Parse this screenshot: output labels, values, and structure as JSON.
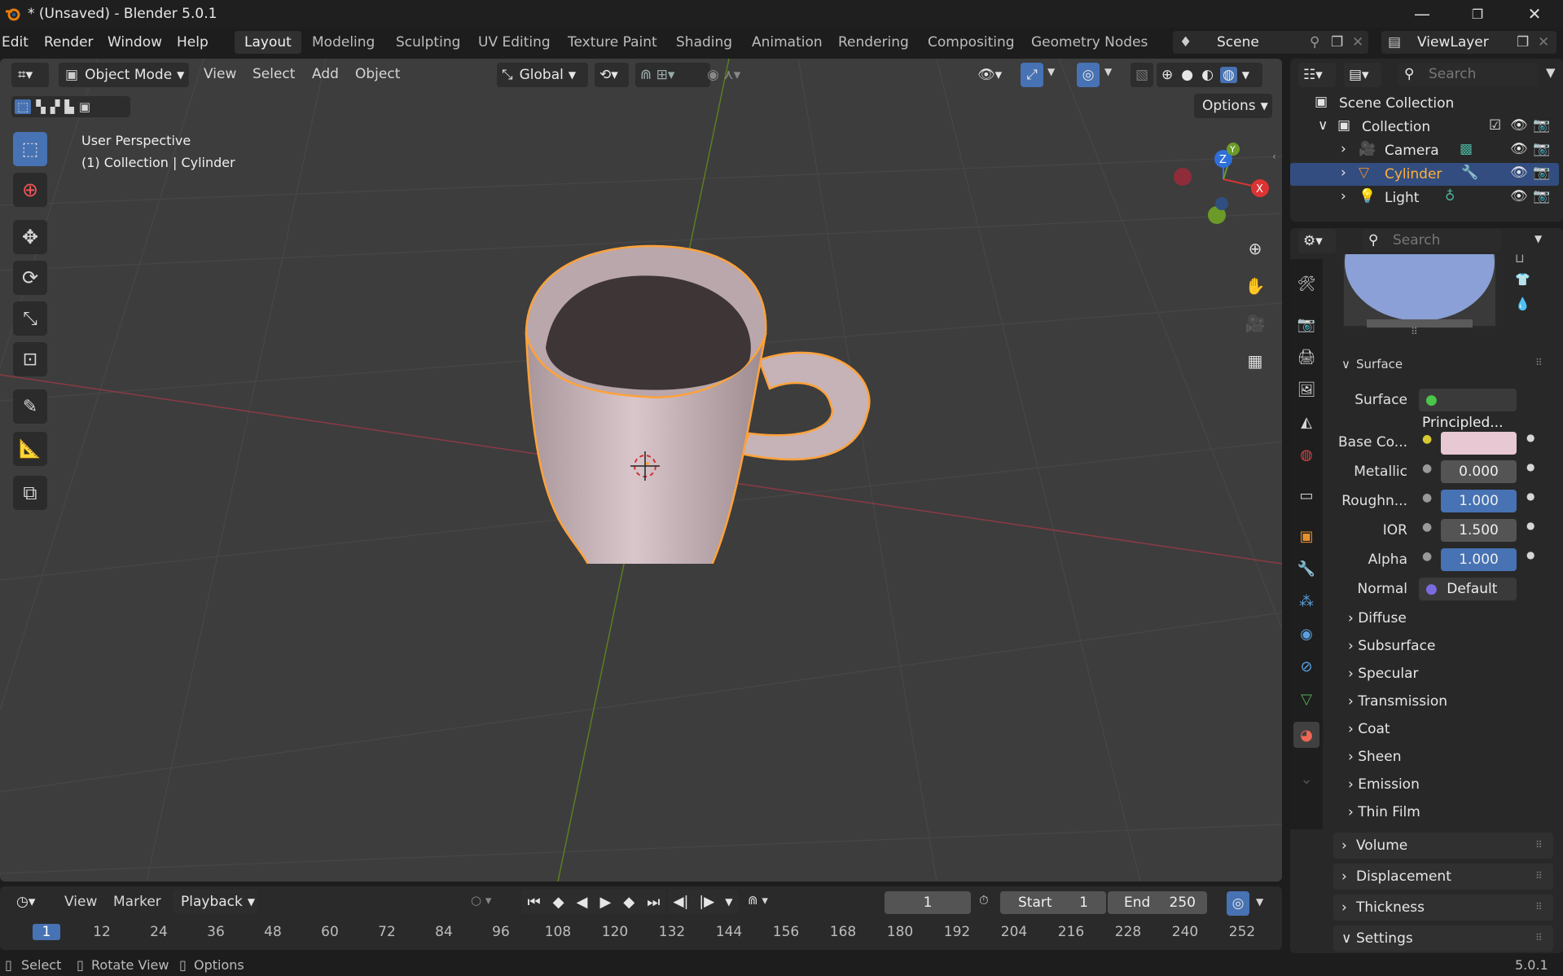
{
  "window": {
    "title": "* (Unsaved) - Blender 5.0.1"
  },
  "menu": {
    "items": [
      "Edit",
      "Render",
      "Window",
      "Help"
    ]
  },
  "workspaces": [
    "Layout",
    "Modeling",
    "Sculpting",
    "UV Editing",
    "Texture Paint",
    "Shading",
    "Animation",
    "Rendering",
    "Compositing",
    "Geometry Nodes"
  ],
  "scene": {
    "name": "Scene",
    "view_layer": "ViewLayer"
  },
  "viewport_header": {
    "mode": "Object Mode",
    "menus": [
      "View",
      "Select",
      "Add",
      "Object"
    ],
    "transform": "Global",
    "options": "Options"
  },
  "viewport_overlay": {
    "perspective": "User Perspective",
    "context": "(1) Collection | Cylinder"
  },
  "gizmo": {
    "x": "X",
    "y": "Y",
    "z": "Z"
  },
  "outliner": {
    "search_placeholder": "Search",
    "root": "Scene Collection",
    "collection": "Collection",
    "items": [
      {
        "name": "Camera"
      },
      {
        "name": "Cylinder"
      },
      {
        "name": "Light"
      }
    ]
  },
  "properties": {
    "search_placeholder": "Search",
    "surface_panel": "Surface",
    "surface_label": "Surface",
    "surface_value": "Principled...",
    "rows": [
      {
        "label": "Base Co...",
        "value": ""
      },
      {
        "label": "Metallic",
        "value": "0.000"
      },
      {
        "label": "Roughn...",
        "value": "1.000"
      },
      {
        "label": "IOR",
        "value": "1.500"
      },
      {
        "label": "Alpha",
        "value": "1.000"
      },
      {
        "label": "Normal",
        "value": "Default"
      }
    ],
    "subpanels": [
      "Diffuse",
      "Subsurface",
      "Specular",
      "Transmission",
      "Coat",
      "Sheen",
      "Emission",
      "Thin Film"
    ],
    "panels": [
      "Volume",
      "Displacement",
      "Thickness",
      "Settings"
    ],
    "base_color": "#e8c8d2"
  },
  "timeline": {
    "menus": [
      "View",
      "Marker",
      "Playback"
    ],
    "current_frame": "1",
    "start_label": "Start",
    "start": "1",
    "end_label": "End",
    "end": "250",
    "ticks": [
      "1",
      "12",
      "24",
      "36",
      "48",
      "60",
      "72",
      "84",
      "96",
      "108",
      "120",
      "132",
      "144",
      "156",
      "168",
      "180",
      "192",
      "204",
      "216",
      "228",
      "240",
      "252"
    ]
  },
  "statusbar": {
    "select": "Select",
    "rotate": "Rotate View",
    "options": "Options",
    "version": "5.0.1"
  },
  "colors": {
    "accent": "#4772b3",
    "selection": "#ffa23a",
    "x_axis": "#c8374a",
    "y_axis": "#6d9a1f"
  }
}
